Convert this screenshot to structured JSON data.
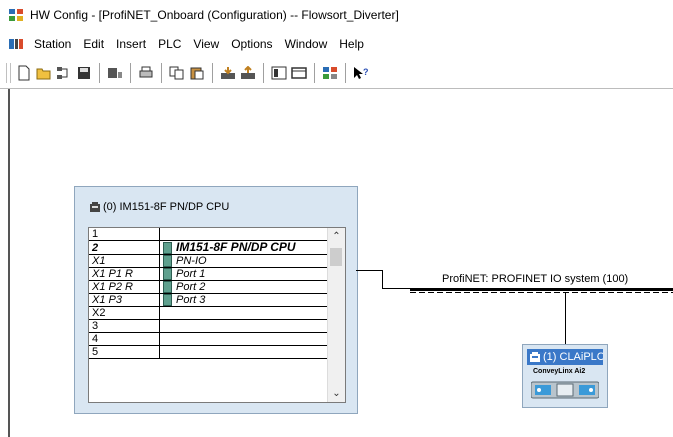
{
  "window": {
    "title": "HW Config - [ProfiNET_Onboard (Configuration) -- Flowsort_Diverter]"
  },
  "menu": [
    "Station",
    "Edit",
    "Insert",
    "PLC",
    "View",
    "Options",
    "Window",
    "Help"
  ],
  "toolbar": {
    "icons": [
      "new-icon",
      "open-icon",
      "network-icon",
      "save-icon",
      "compile-icon",
      "print-icon",
      "copy-icon",
      "paste-icon",
      "download-icon",
      "upload-icon",
      "catalog-icon",
      "module-icon",
      "netpro-icon",
      "help-cursor-icon"
    ]
  },
  "station": {
    "title": "(0) IM151-8F PN/DP CPU",
    "rows": [
      {
        "slot": "1",
        "module": "",
        "style": "normal"
      },
      {
        "slot": "2",
        "module": "IM151-8F PN/DP CPU",
        "style": "bold-italic"
      },
      {
        "slot": "X1",
        "module": "PN-IO",
        "style": "italic"
      },
      {
        "slot": "X1 P1 R",
        "module": "Port 1",
        "style": "italic"
      },
      {
        "slot": "X1 P2 R",
        "module": "Port 2",
        "style": "italic"
      },
      {
        "slot": "X1 P3",
        "module": "Port 3",
        "style": "italic"
      },
      {
        "slot": "X2",
        "module": "",
        "style": "normal"
      },
      {
        "slot": "3",
        "module": "",
        "style": "normal"
      },
      {
        "slot": "4",
        "module": "",
        "style": "normal"
      },
      {
        "slot": "5",
        "module": "",
        "style": "normal"
      }
    ]
  },
  "network": {
    "label": "ProfiNET: PROFINET IO system (100)"
  },
  "device": {
    "title": "(1) CLAiPLC",
    "subtitle": "ConveyLinx Ai2"
  },
  "colors": {
    "device_title_bg": "#3a78c8",
    "station_bg": "#d9e6f2",
    "module_icon": "#5fa08e"
  }
}
